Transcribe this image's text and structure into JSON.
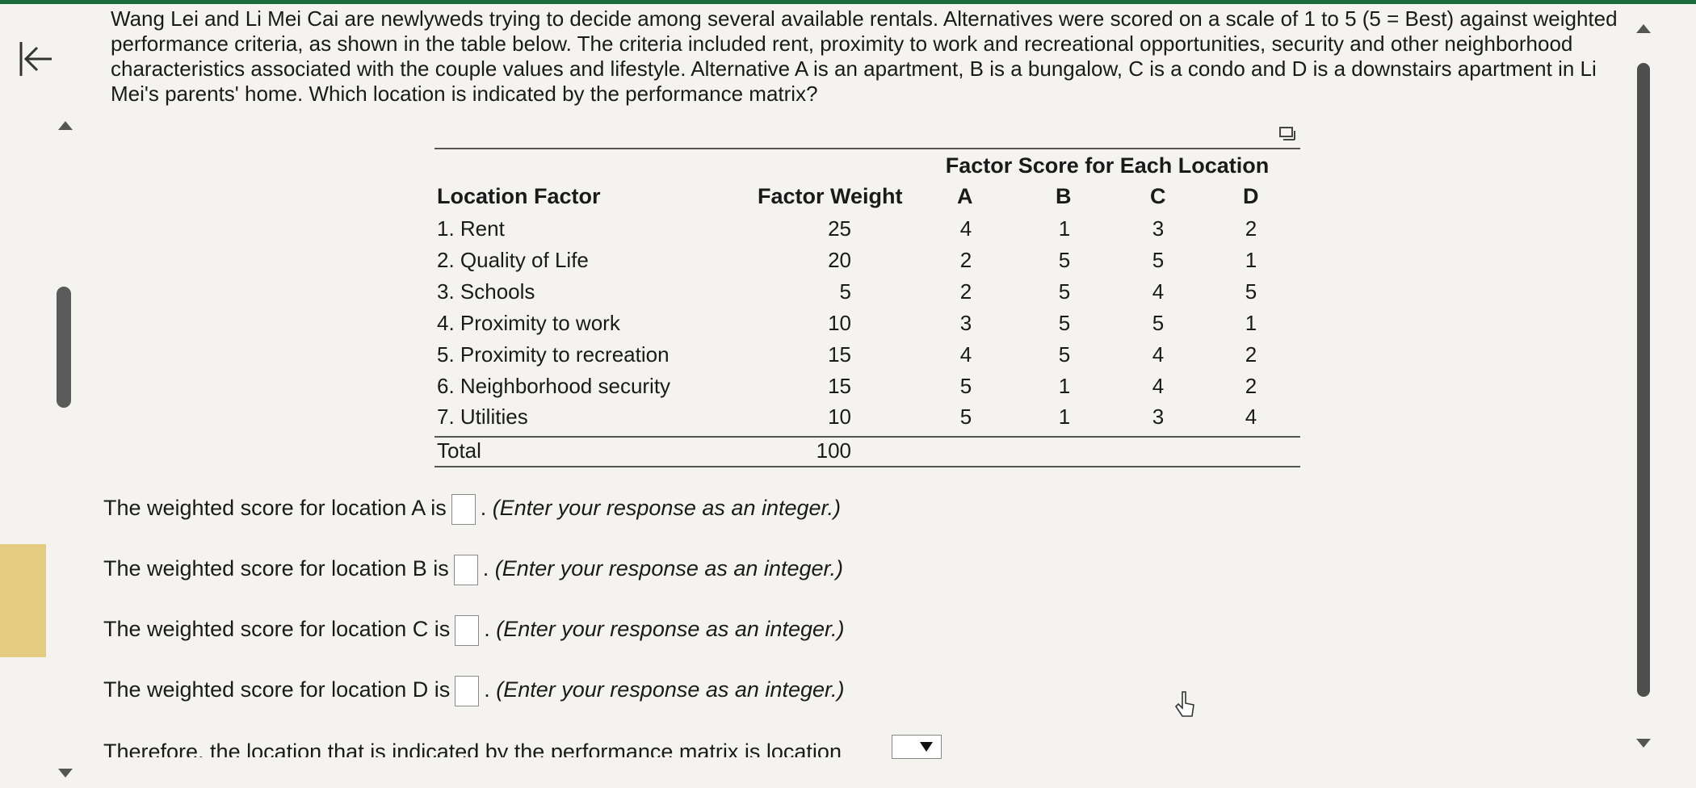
{
  "question_text": "Wang Lei and Li Mei Cai are newlyweds trying to decide among several available rentals. Alternatives were scored on a scale of 1 to 5 (5 = Best) against weighted performance criteria, as shown in the table below. The criteria included rent, proximity to work and recreational opportunities, security and other neighborhood characteristics associated with the couple values and lifestyle. Alternative A is an apartment, B is a bungalow, C is a condo and D is a downstairs apartment in Li Mei's parents' home. Which location is indicated by the performance matrix?",
  "table": {
    "group_header": "Factor Score for Each Location",
    "col_factor": "Location Factor",
    "col_weight": "Factor Weight",
    "col_a": "A",
    "col_b": "B",
    "col_c": "C",
    "col_d": "D",
    "rows": [
      {
        "factor": "1. Rent",
        "weight": "25",
        "a": "4",
        "b": "1",
        "c": "3",
        "d": "2"
      },
      {
        "factor": "2. Quality of Life",
        "weight": "20",
        "a": "2",
        "b": "5",
        "c": "5",
        "d": "1"
      },
      {
        "factor": "3. Schools",
        "weight": "5",
        "a": "2",
        "b": "5",
        "c": "4",
        "d": "5"
      },
      {
        "factor": "4. Proximity to work",
        "weight": "10",
        "a": "3",
        "b": "5",
        "c": "5",
        "d": "1"
      },
      {
        "factor": "5. Proximity to recreation",
        "weight": "15",
        "a": "4",
        "b": "5",
        "c": "4",
        "d": "2"
      },
      {
        "factor": "6. Neighborhood security",
        "weight": "15",
        "a": "5",
        "b": "1",
        "c": "4",
        "d": "2"
      },
      {
        "factor": "7. Utilities",
        "weight": "10",
        "a": "5",
        "b": "1",
        "c": "3",
        "d": "4"
      }
    ],
    "total_label": "Total",
    "total_weight": "100"
  },
  "answers": {
    "a_label": "The weighted score for location A is",
    "b_label": "The weighted score for location B is",
    "c_label": "The weighted score for location C is",
    "d_label": "The weighted score for location D is",
    "hint": "(Enter your response as an integer.)",
    "period": "."
  },
  "conclusion_text": "Therefore, the location that is indicated by the performance matrix is location",
  "icons": {
    "back": "collapse-left-arrow-icon",
    "expand": "expand-table-icon",
    "cursor": "mouse-pointer-icon"
  },
  "colors": {
    "accent_bar": "#1c6b3a",
    "sidebar_tab": "#e6cc80"
  }
}
